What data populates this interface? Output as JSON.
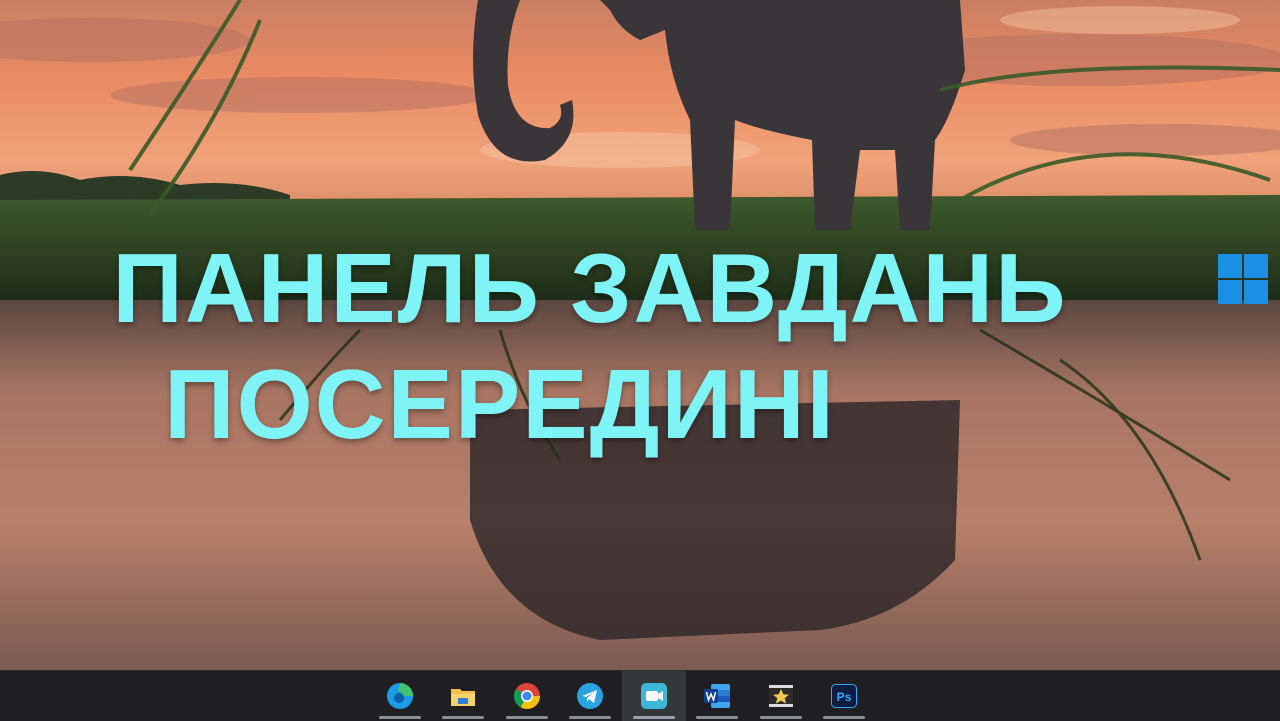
{
  "thumbnail": {
    "title_line_1": "ПАНЕЛЬ ЗАВДАНЬ",
    "title_line_2": "ПОСЕРЕДИНІ",
    "title_color": "#7ff4f6",
    "logo": "windows-logo-icon"
  },
  "taskbar": {
    "background": "#1f1f22",
    "items": [
      {
        "name": "edge",
        "icon": "edge-icon",
        "running": true,
        "active": false
      },
      {
        "name": "file-explorer",
        "icon": "folder-icon",
        "running": true,
        "active": false
      },
      {
        "name": "chrome",
        "icon": "chrome-icon",
        "running": true,
        "active": false
      },
      {
        "name": "telegram",
        "icon": "telegram-icon",
        "running": true,
        "active": false
      },
      {
        "name": "screen-recorder",
        "icon": "camera-icon",
        "running": true,
        "active": true
      },
      {
        "name": "word",
        "icon": "word-icon",
        "running": true,
        "active": false
      },
      {
        "name": "movie-maker",
        "icon": "film-star-icon",
        "running": true,
        "active": false
      },
      {
        "name": "photoshop",
        "icon": "photoshop-icon",
        "running": true,
        "active": false,
        "label": "Ps"
      }
    ]
  },
  "wallpaper": {
    "subject": "elephant-at-sunset",
    "sky_color": "#e98a62",
    "water_color": "#9a6a5a"
  }
}
